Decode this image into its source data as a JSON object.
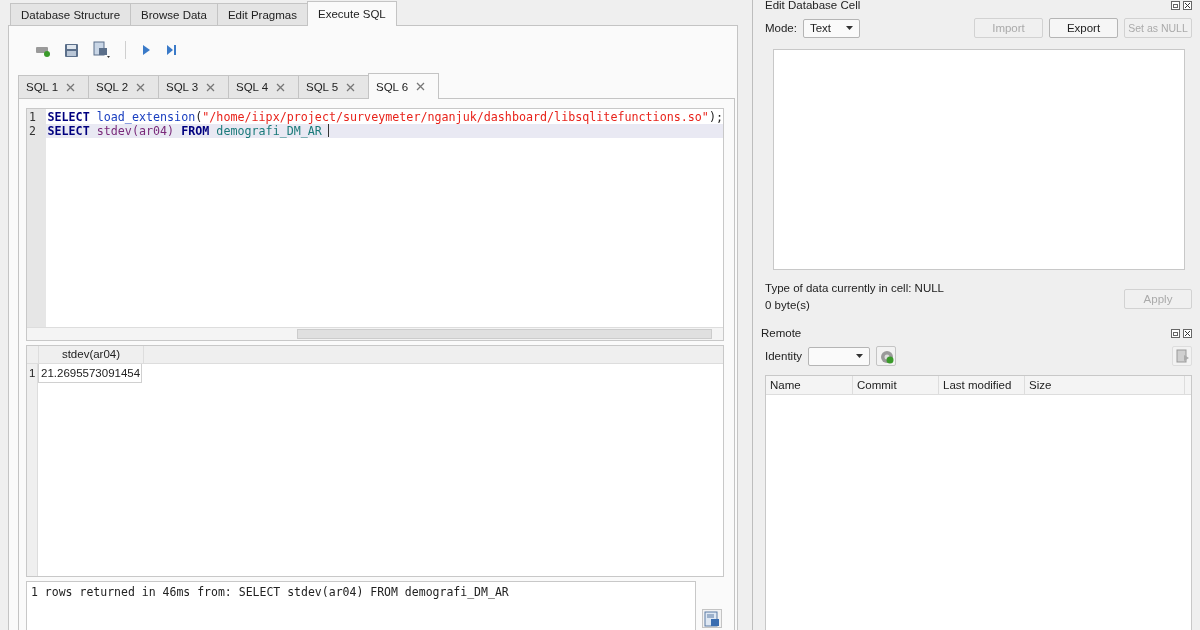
{
  "main_tabs": [
    {
      "label": "Database Structure",
      "selected": false
    },
    {
      "label": "Browse Data",
      "selected": false
    },
    {
      "label": "Edit Pragmas",
      "selected": false
    },
    {
      "label": "Execute SQL",
      "selected": true
    }
  ],
  "sql_tabs": [
    {
      "label": "SQL 1",
      "selected": false
    },
    {
      "label": "SQL 2",
      "selected": false
    },
    {
      "label": "SQL 3",
      "selected": false
    },
    {
      "label": "SQL 4",
      "selected": false
    },
    {
      "label": "SQL 5",
      "selected": false
    },
    {
      "label": "SQL 6",
      "selected": true
    }
  ],
  "editor": {
    "lines": [
      {
        "number": "1",
        "current": false,
        "tokens": [
          {
            "kind": "keyword",
            "text": "SELECT "
          },
          {
            "kind": "function",
            "text": "load_extension"
          },
          {
            "kind": "plain",
            "text": "("
          },
          {
            "kind": "string",
            "text": "\"/home/iipx/project/surveymeter/nganjuk/dashboard/libsqlitefunctions.so\""
          },
          {
            "kind": "plain",
            "text": ");"
          }
        ]
      },
      {
        "number": "2",
        "current": true,
        "tokens": [
          {
            "kind": "keyword",
            "text": "SELECT "
          },
          {
            "kind": "identifier",
            "text": "stdev(ar04) "
          },
          {
            "kind": "keyword",
            "text": "FROM "
          },
          {
            "kind": "table",
            "text": "demografi_DM_AR"
          }
        ]
      }
    ]
  },
  "results": {
    "columns": [
      "stdev(ar04)"
    ],
    "rows": [
      {
        "number": "1",
        "cells": [
          "21.2695573091454"
        ]
      }
    ]
  },
  "message": "1 rows returned in 46ms from: SELECT stdev(ar04) FROM demografi_DM_AR",
  "edit_cell": {
    "title": "Edit Database Cell",
    "mode_label": "Mode:",
    "mode": "Text",
    "buttons": [
      {
        "label": "Import",
        "disabled": true
      },
      {
        "label": "Export",
        "disabled": false
      },
      {
        "label": "Set as NULL",
        "disabled": true
      }
    ],
    "type_info": "Type of data currently in cell: NULL",
    "size_info": "0 byte(s)",
    "apply": {
      "label": "Apply",
      "disabled": true
    }
  },
  "remote": {
    "title": "Remote",
    "identity_label": "Identity",
    "columns": [
      "Name",
      "Commit",
      "Last modified",
      "Size"
    ]
  }
}
